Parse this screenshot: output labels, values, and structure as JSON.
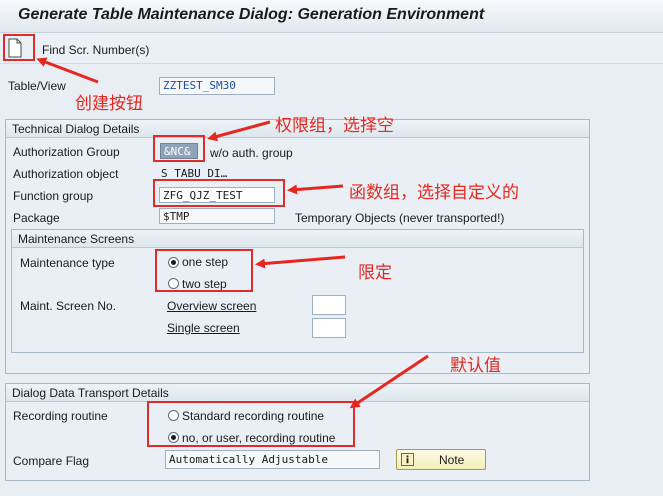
{
  "window": {
    "title": "Generate Table Maintenance Dialog: Generation Environment"
  },
  "toolbar": {
    "new_icon": "new-document-icon",
    "find_label": "Find Scr. Number(s)"
  },
  "table_view": {
    "label": "Table/View",
    "value": "ZZTEST_SM30"
  },
  "technical": {
    "header": "Technical Dialog Details",
    "auth_group_label": "Authorization Group",
    "auth_group_value": "&NC&",
    "auth_group_text": "w/o auth. group",
    "auth_object_label": "Authorization object",
    "auth_object_value": "S_TABU_DI…",
    "function_group_label": "Function group",
    "function_group_value": "ZFG_QJZ_TEST",
    "package_label": "Package",
    "package_value": "$TMP",
    "package_text": "Temporary Objects (never transported!)"
  },
  "maintenance": {
    "header": "Maintenance Screens",
    "type_label": "Maintenance type",
    "option_one": "one step",
    "option_two": "two step",
    "selected": "one step",
    "screen_no_label": "Maint. Screen No.",
    "overview_label": "Overview screen",
    "overview_value": "",
    "single_label": "Single screen",
    "single_value": ""
  },
  "transport": {
    "header": "Dialog Data Transport Details",
    "recording_label": "Recording routine",
    "option_standard": "Standard recording routine",
    "option_user": "no, or user, recording routine",
    "selected": "no, or user, recording routine",
    "compare_label": "Compare Flag",
    "compare_value": "Automatically Adjustable",
    "note_label": "Note",
    "note_icon": "info-icon"
  },
  "annotations": {
    "create_button": "创建按钮",
    "auth_group_hint": "权限组，选择空",
    "function_group_hint": "函数组，选择自定义的",
    "limit_hint": "限定",
    "default_hint": "默认值"
  },
  "colors": {
    "annotation_red": "#e02b2b",
    "link_blue": "#1c4fa0"
  }
}
